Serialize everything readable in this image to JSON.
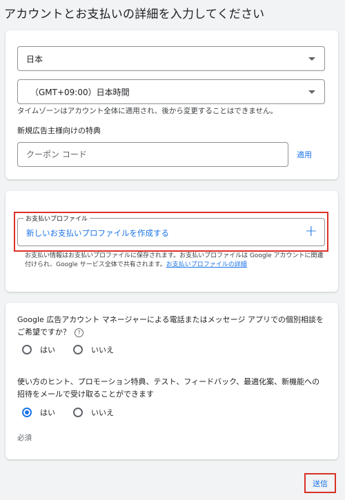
{
  "page": {
    "title": "アカウントとお支払いの詳細を入力してください"
  },
  "account": {
    "country_value": "日本",
    "timezone_value": "（GMT+09:00）日本時間",
    "timezone_help": "タイムゾーンはアカウント全体に適用され、後から変更することはできません。",
    "coupon_label": "新規広告主様向けの特典",
    "coupon_placeholder": "クーポン コード",
    "apply_label": "適用"
  },
  "payment": {
    "legend": "お支払いプロファイル",
    "create_label": "新しいお支払いプロファイルを作成する",
    "plus_glyph": "+",
    "help_text": "お支払い情報はお支払いプロファイルに保存されます。お支払いプロファイルは Google アカウントに関連付けられ、Google サービス全体で共有されます。",
    "help_link": "お支払いプロファイルの詳細"
  },
  "preferences": {
    "q1": "Google 広告アカウント マネージャーによる電話またはメッセージ アプリでの個別相談をご希望ですか？",
    "q1_help_glyph": "?",
    "q1_yes": "はい",
    "q1_no": "いいえ",
    "q1_selected": "none",
    "q2": "使い方のヒント、プロモーション特典、テスト、フィードバック、最適化案、新機能への招待をメールで受け取ることができます",
    "q2_yes": "はい",
    "q2_no": "いいえ",
    "q2_selected": "yes",
    "required_label": "必須"
  },
  "footer": {
    "submit_label": "送信"
  },
  "colors": {
    "accent": "#1a73e8",
    "highlight": "#d93025"
  }
}
